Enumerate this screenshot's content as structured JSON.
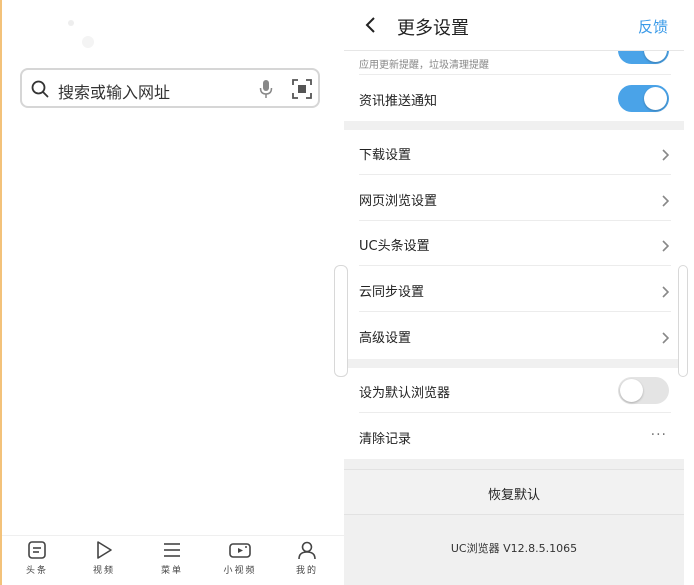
{
  "left": {
    "search": {
      "placeholder": "搜索或输入网址"
    },
    "nav": [
      {
        "label": "头条",
        "icon": "headline-icon"
      },
      {
        "label": "视频",
        "icon": "play-icon"
      },
      {
        "label": "菜单",
        "icon": "menu-icon"
      },
      {
        "label": "小视频",
        "icon": "camera-icon"
      },
      {
        "label": "我的",
        "icon": "profile-icon"
      }
    ]
  },
  "settings": {
    "title": "更多设置",
    "feedback": "反馈",
    "notif_sub": "应用更新提醒，垃圾清理提醒",
    "group1": [
      {
        "label": "资讯推送通知",
        "toggle": true
      }
    ],
    "group2": [
      {
        "label": "下载设置"
      },
      {
        "label": "网页浏览设置"
      },
      {
        "label": "UC头条设置"
      },
      {
        "label": "云同步设置"
      },
      {
        "label": "高级设置"
      }
    ],
    "group3": [
      {
        "label": "设为默认浏览器",
        "toggle": false
      },
      {
        "label": "清除记录",
        "more": "···"
      }
    ],
    "restore": "恢复默认",
    "version": "UC浏览器 V12.8.5.1065"
  },
  "colors": {
    "accent": "#4aa3e8",
    "link": "#3a9ae8",
    "panel_bg": "#f0f0f0"
  }
}
